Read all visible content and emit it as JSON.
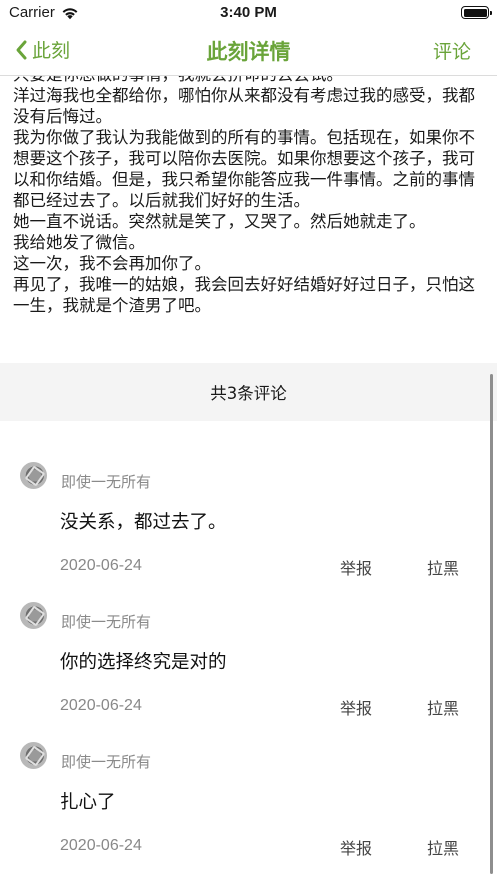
{
  "status_bar": {
    "carrier": "Carrier",
    "time": "3:40 PM"
  },
  "nav": {
    "back_label": "此刻",
    "title": "此刻详情",
    "right_label": "评论",
    "accent_color": "#6aa43a"
  },
  "article": {
    "paragraphs": [
      "只要是你想做的事情，我就会拼命的去尝试。",
      "洋过海我也全都给你，哪怕你从来都没有考虑过我的感受，我都没有后悔过。",
      "我为你做了我认为我能做到的所有的事情。包括现在，如果你不想要这个孩子，我可以陪你去医院。如果你想要这个孩子，我可以和你结婚。但是，我只希望你能答应我一件事情。之前的事情都已经过去了。以后就我们好好的生活。",
      "她一直不说话。突然就是笑了，又哭了。然后她就走了。",
      "我给她发了微信。",
      "这一次，我不会再加你了。",
      "再见了，我唯一的姑娘，我会回去好好结婚好好过日子，只怕这一生，我就是个渣男了吧。"
    ]
  },
  "comments_header": "共3条评论",
  "comments": [
    {
      "user": "即使一无所有",
      "text": "没关系，都过去了。",
      "date": "2020-06-24",
      "report_label": "举报",
      "block_label": "拉黑"
    },
    {
      "user": "即使一无所有",
      "text": "你的选择终究是对的",
      "date": "2020-06-24",
      "report_label": "举报",
      "block_label": "拉黑"
    },
    {
      "user": "即使一无所有",
      "text": "扎心了",
      "date": "2020-06-24",
      "report_label": "举报",
      "block_label": "拉黑"
    }
  ]
}
